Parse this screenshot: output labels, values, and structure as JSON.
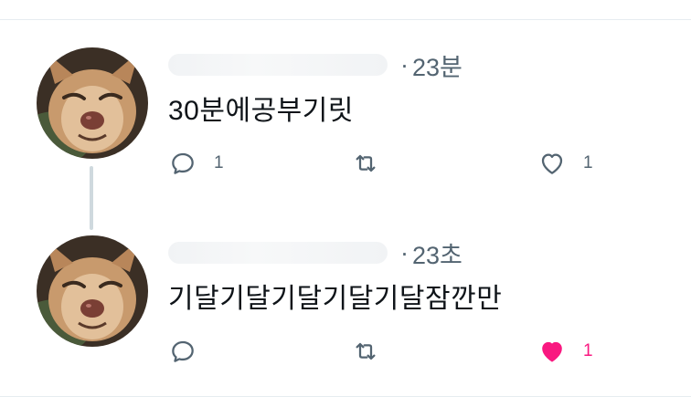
{
  "colors": {
    "text": "#0f1419",
    "secondary": "#536471",
    "like_active": "#f91880",
    "divider": "#e6ecf0",
    "thread_line": "#cfd9de"
  },
  "tweets": [
    {
      "separator": "·",
      "time": "23분",
      "text": "30분에공부기릿",
      "reply_count": "1",
      "retweet_count": "",
      "like_count": "1",
      "liked": false
    },
    {
      "separator": "·",
      "time": "23초",
      "text": "기달기달기달기달기달잠깐만",
      "reply_count": "",
      "retweet_count": "",
      "like_count": "1",
      "liked": true
    }
  ],
  "icons": {
    "reply": "reply-icon",
    "retweet": "retweet-icon",
    "like": "heart-icon",
    "like_active": "heart-filled-icon",
    "avatar": "chihuahua-avatar"
  }
}
